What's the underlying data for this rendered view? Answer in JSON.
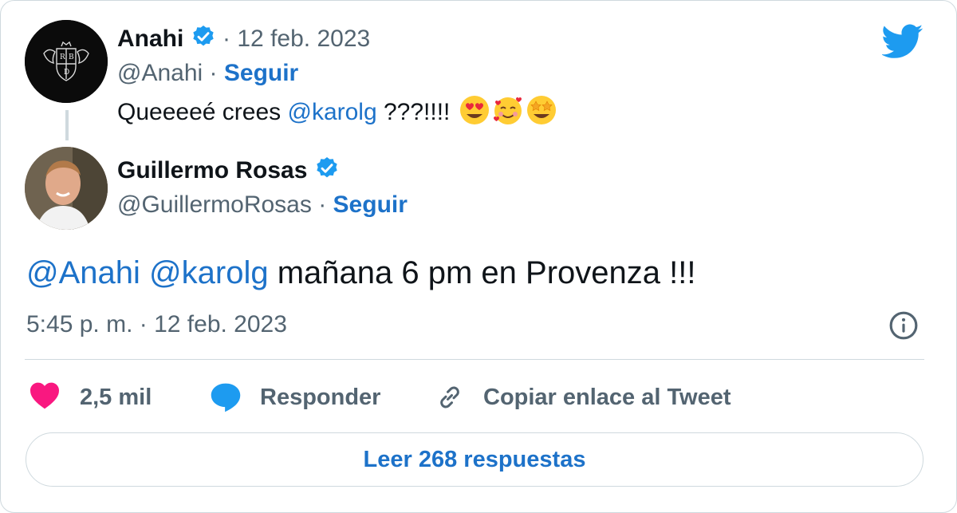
{
  "parent_tweet": {
    "author_name": "Anahi",
    "date": "12 feb. 2023",
    "handle": "@Anahi",
    "follow_label": "Seguir",
    "text_before": "Queeeeé crees ",
    "mention": "@karolg",
    "text_after": " ???!!!!",
    "emojis": [
      "heart-eyes-emoji",
      "smiling-face-with-hearts-emoji",
      "star-struck-emoji"
    ],
    "avatar_icon": "rbd-logo-avatar"
  },
  "reply_tweet": {
    "author_name": "Guillermo Rosas",
    "handle": "@GuillermoRosas",
    "follow_label": "Seguir",
    "mention_1": "@Anahi",
    "mention_2": "@karolg",
    "text": " mañana 6 pm en Provenza !!!",
    "time": "5:45 p. m.",
    "date": "12 feb. 2023",
    "avatar_icon": "profile-photo-avatar"
  },
  "separator": "·",
  "actions": {
    "likes": "2,5 mil",
    "reply_label": "Responder",
    "copy_label": "Copiar enlace al Tweet"
  },
  "read_replies_label": "Leer 268 respuestas",
  "colors": {
    "twitter_blue": "#1d9bf0",
    "link_blue": "#1d72c9",
    "like_pink": "#f91880",
    "muted_gray": "#536471",
    "border": "#cfd9de"
  }
}
